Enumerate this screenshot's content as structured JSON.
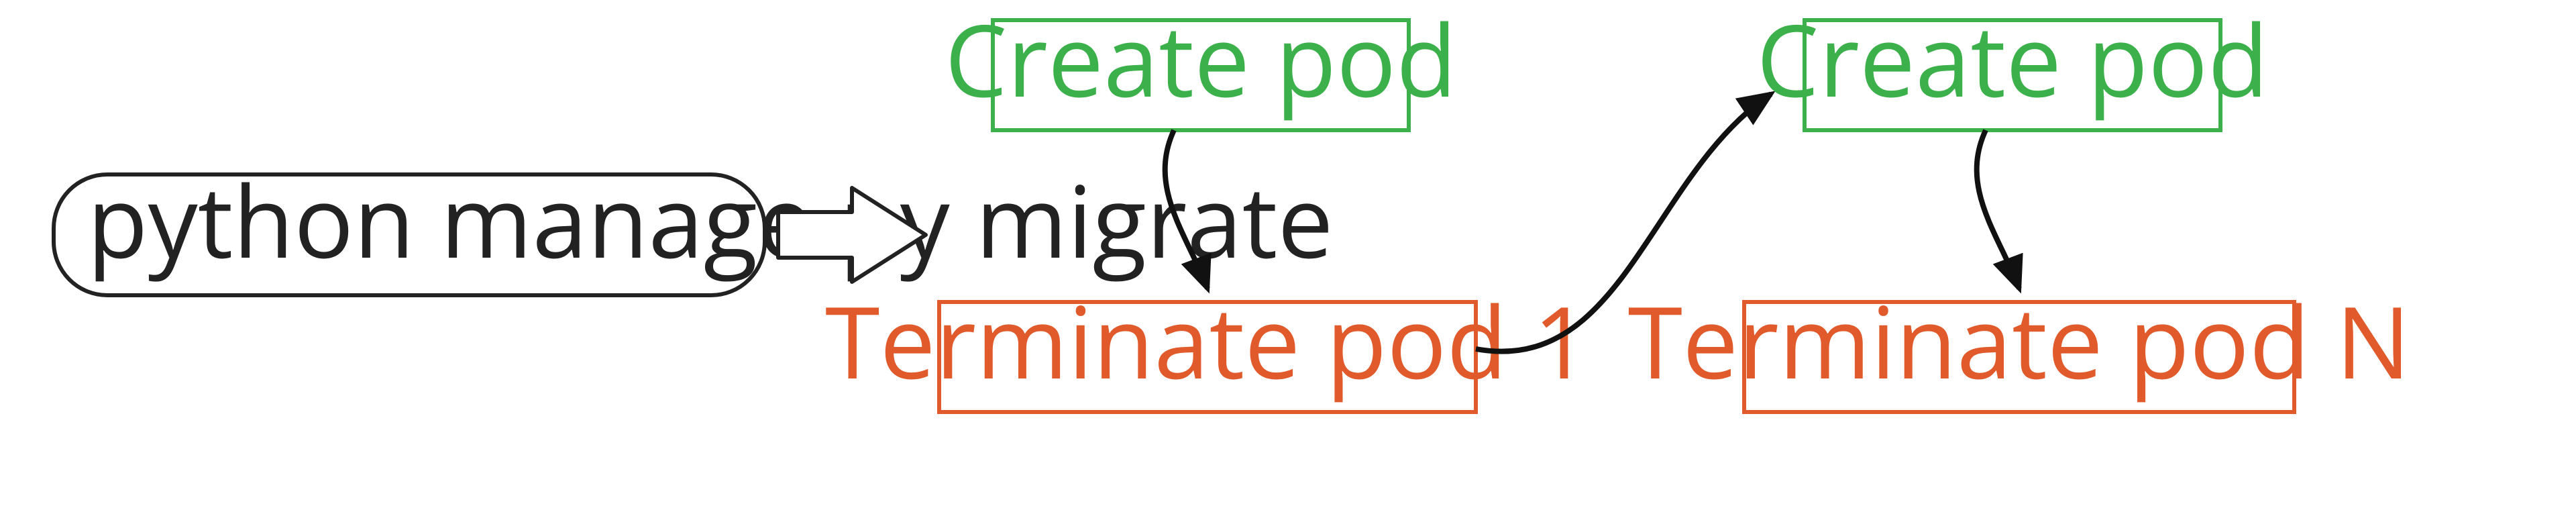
{
  "command": {
    "label": "python manage.py migrate"
  },
  "step1": {
    "create": "Create pod",
    "terminate": "Terminate pod 1"
  },
  "step2": {
    "create": "Create pod",
    "terminate": "Terminate pod N"
  },
  "colors": {
    "green": "#3bb04b",
    "red": "#e05a2b",
    "stroke": "#222222"
  }
}
